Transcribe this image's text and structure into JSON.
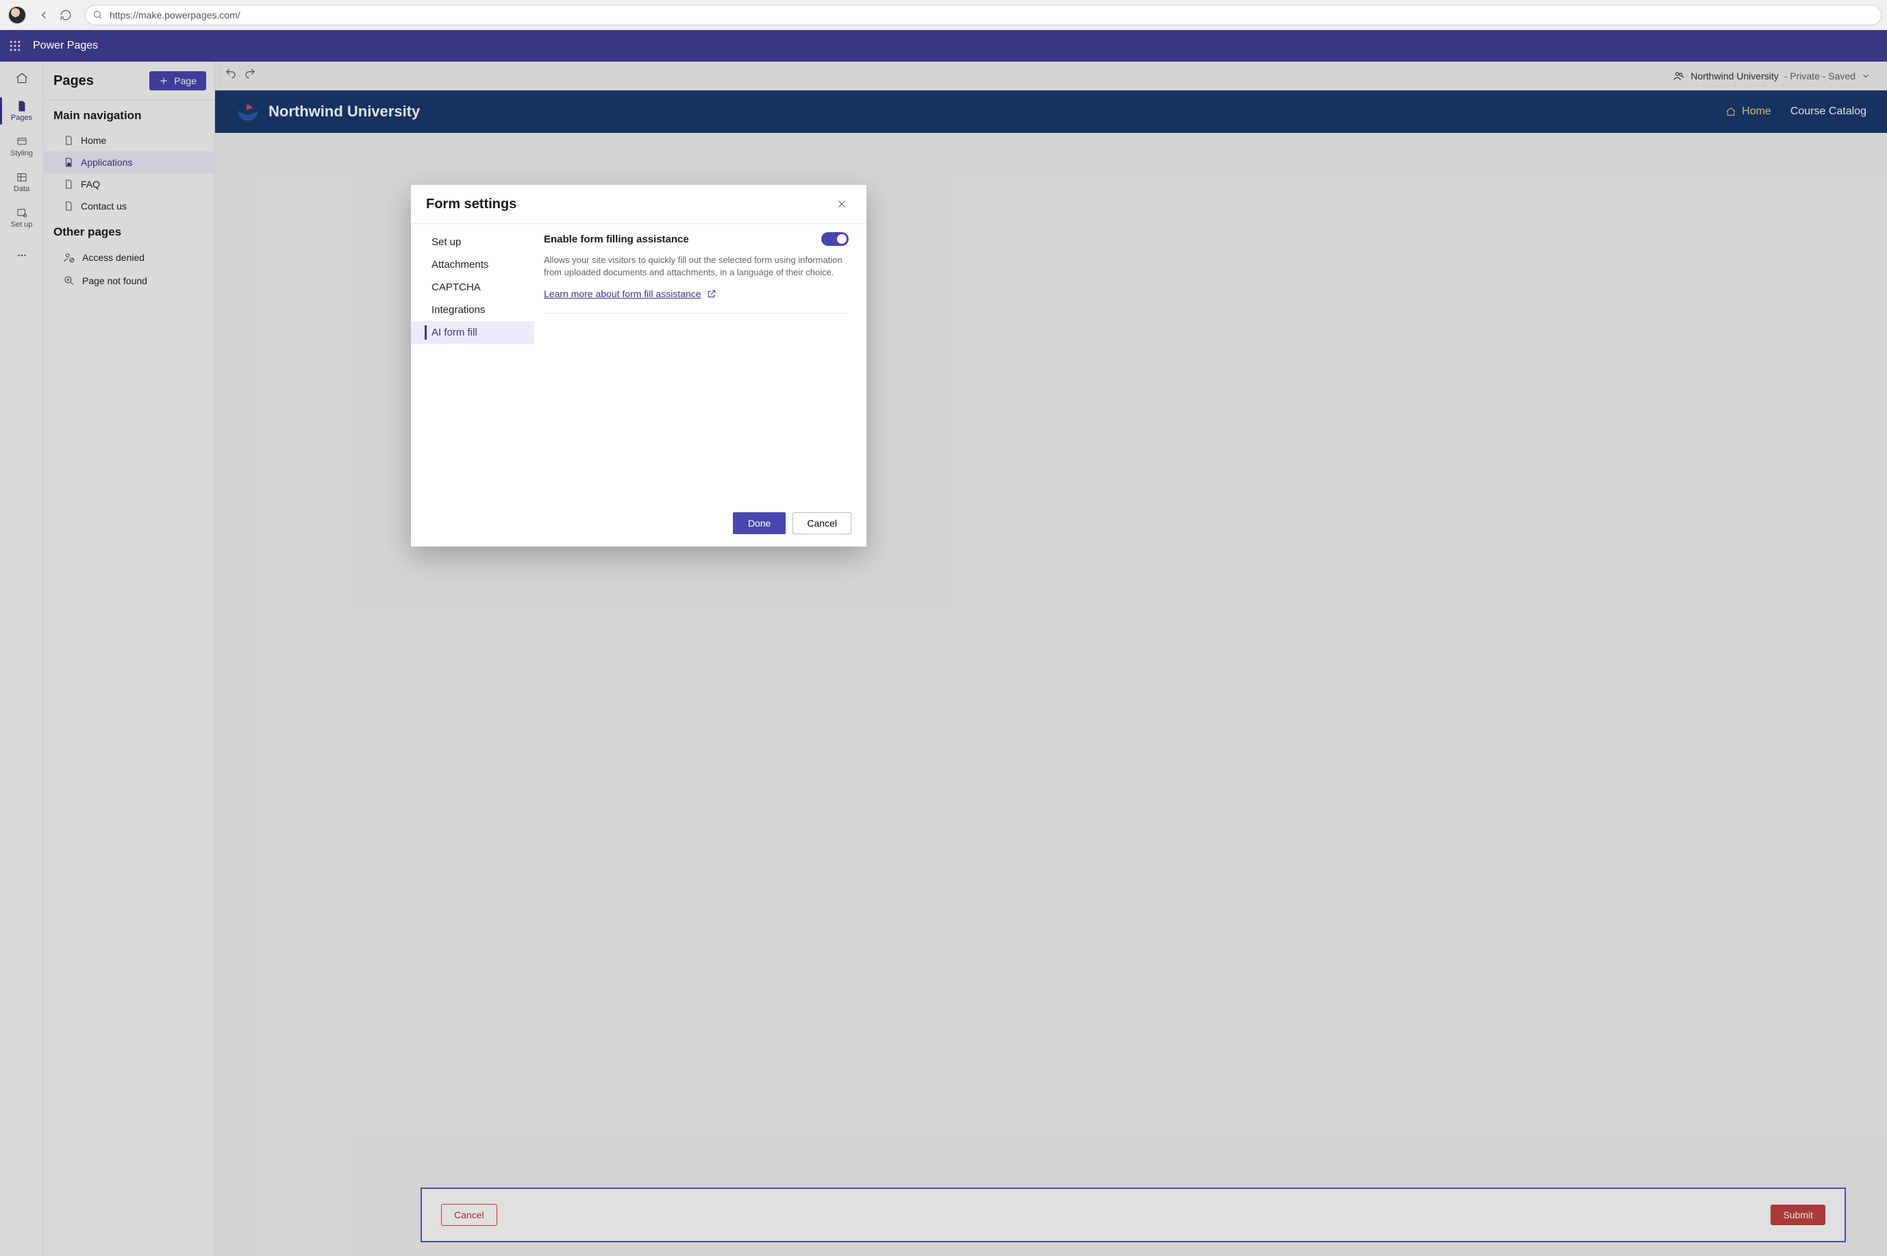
{
  "browser": {
    "url": "https://make.powerpages.com/"
  },
  "appHeader": {
    "title": "Power Pages"
  },
  "leftRail": {
    "pages": "Pages",
    "styling": "Styling",
    "data": "Data",
    "setup": "Set up"
  },
  "pagesPanel": {
    "heading": "Pages",
    "addPage": "Page",
    "mainNavTitle": "Main navigation",
    "mainNav": {
      "home": "Home",
      "applications": "Applications",
      "faq": "FAQ",
      "contact": "Contact us"
    },
    "otherTitle": "Other pages",
    "other": {
      "accessDenied": "Access denied",
      "notFound": "Page not found"
    }
  },
  "siteBar": {
    "siteName": "Northwind University",
    "status": " - Private - Saved"
  },
  "preview": {
    "brandName": "Northwind University",
    "navHome": "Home",
    "navCatalog": "Course Catalog",
    "cancel": "Cancel",
    "submit": "Submit"
  },
  "modal": {
    "title": "Form settings",
    "nav": {
      "setup": "Set up",
      "attachments": "Attachments",
      "captcha": "CAPTCHA",
      "integrations": "Integrations",
      "aiFormFill": "AI form fill"
    },
    "settingTitle": "Enable form filling assistance",
    "settingDesc": "Allows your site visitors to quickly fill out the selected form using information from uploaded documents and attachments, in a language of their choice.",
    "learnMore": "Learn more about form fill assistance",
    "done": "Done",
    "cancel": "Cancel"
  }
}
